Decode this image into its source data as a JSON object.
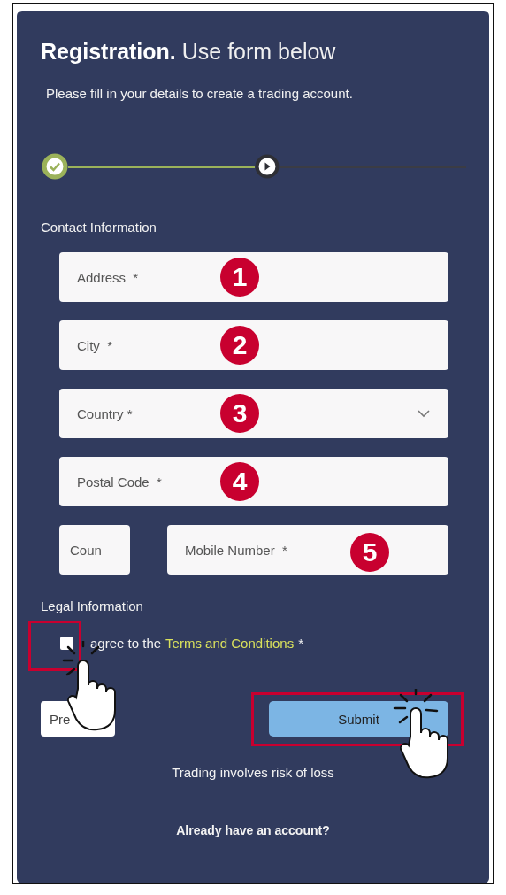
{
  "title": {
    "bold": "Registration.",
    "rest": "Use form below"
  },
  "subtitle": "Please fill in your details to create a trading account.",
  "steps": [
    {
      "kind": "done"
    },
    {
      "kind": "current"
    }
  ],
  "contact": {
    "heading": "Contact Information",
    "fields": [
      {
        "kind": "text",
        "placeholder": "Address  *",
        "badge": "1"
      },
      {
        "kind": "text",
        "placeholder": "City  *",
        "badge": "2"
      },
      {
        "kind": "select",
        "placeholder": "Country *",
        "badge": "3"
      },
      {
        "kind": "text",
        "placeholder": "Postal Code  *",
        "badge": "4"
      }
    ],
    "phone": {
      "code": {
        "placeholder": "Coun"
      },
      "number": {
        "placeholder": "Mobile Number  *",
        "badge": "5"
      }
    }
  },
  "legal": {
    "heading": "Legal Information",
    "agree": {
      "checked": false,
      "text": "agree to the",
      "link": "Terms and Conditions",
      "suffix": "*"
    }
  },
  "buttons": {
    "previous": "Pre",
    "submit": "Submit"
  },
  "disclaimer": "Trading involves risk of loss",
  "login_prompt": "Already have an account?"
}
